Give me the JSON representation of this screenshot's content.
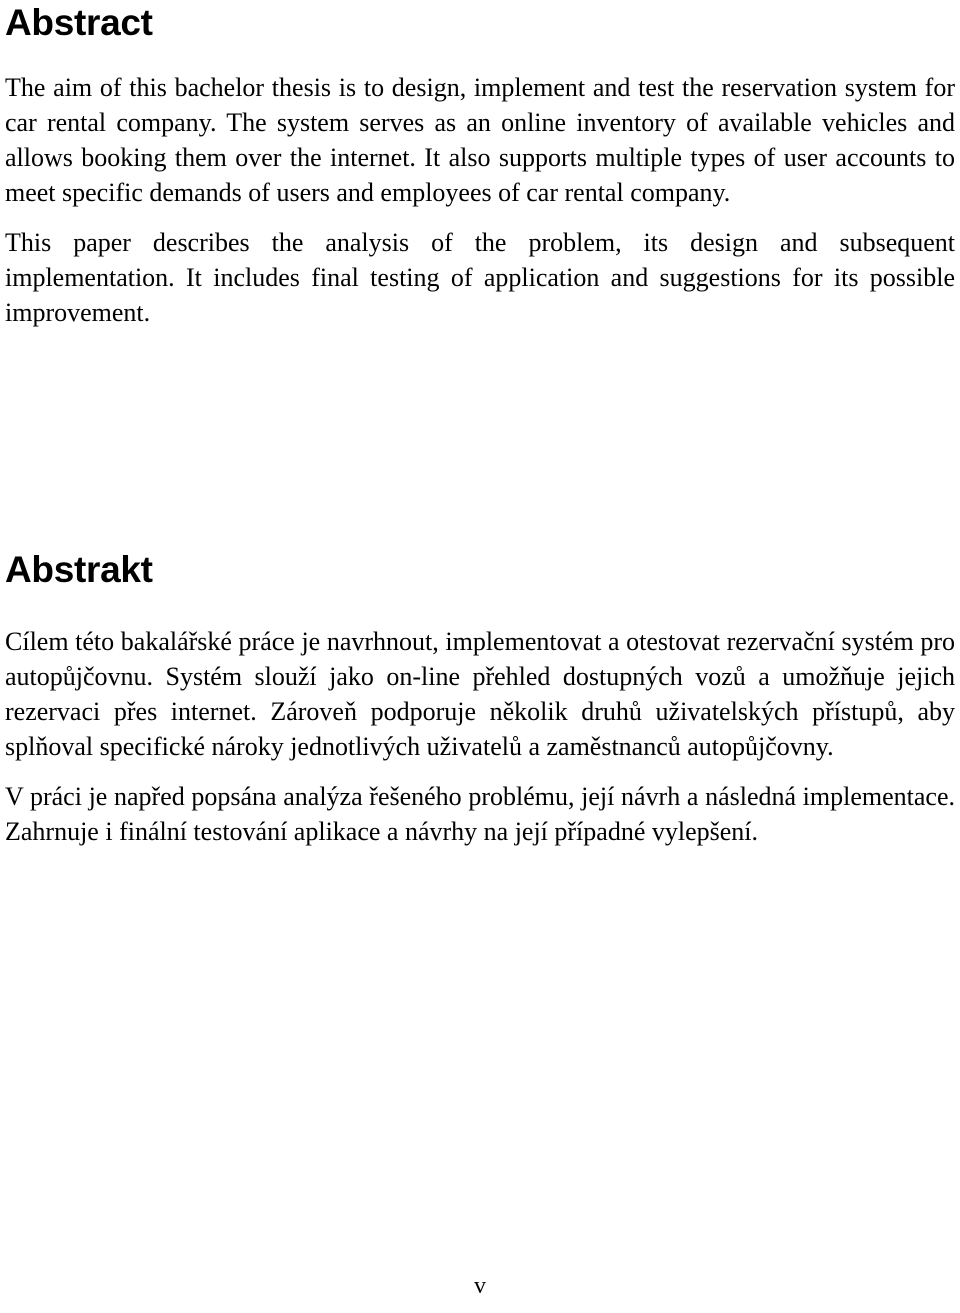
{
  "document": {
    "page_number": "v",
    "background_color": "#ffffff",
    "text_color": "#000000"
  },
  "abstract_en": {
    "heading": "Abstract",
    "paragraphs": [
      "The aim of this bachelor thesis is to design, implement and test the reservation system for car rental company. The system serves as an online inventory of available vehicles and allows booking them over the internet. It also supports multiple types of user accounts to meet specific demands of users and employees of car rental company.",
      "This paper describes the analysis of the problem, its design and subsequent implementation. It includes final testing of application and suggestions for its possible improvement."
    ]
  },
  "abstract_cs": {
    "heading": "Abstrakt",
    "paragraphs": [
      "Cílem této bakalářské práce je navrhnout, implementovat a otestovat rezervační systém pro autopůjčovnu. Systém slouží jako on-line přehled dostupných vozů a umožňuje jejich rezervaci přes internet. Zároveň podporuje několik druhů uživatelských přístupů, aby splňoval specifické nároky jednotlivých uživatelů a zaměstnanců autopůjčovny.",
      "V práci je napřed popsána analýza řešeného problému, její návrh a následná implementace. Zahrnuje i finální testování aplikace a návrhy na její případné vylepšení."
    ]
  }
}
